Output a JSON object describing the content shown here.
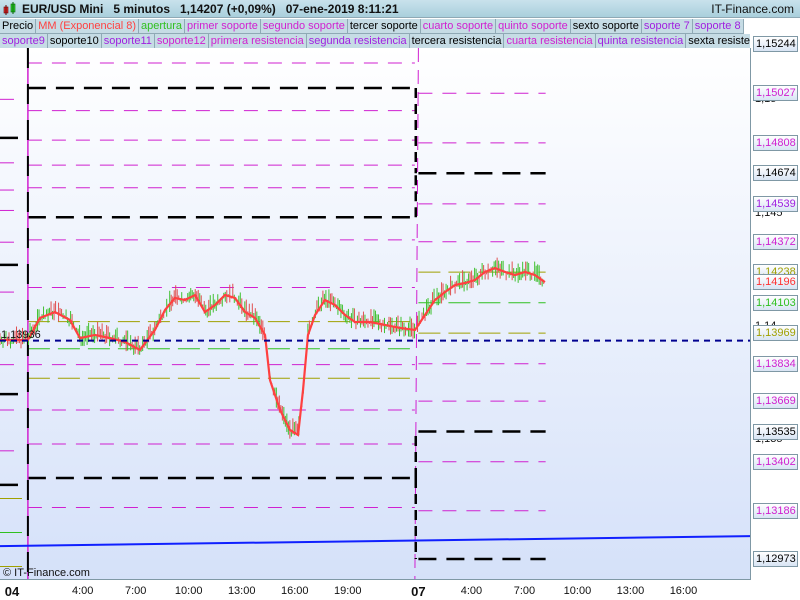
{
  "header": {
    "title": "EUR/USD Mini   5 minutos   1,14207 (+0,09%)   07-ene-2019 8:11:21",
    "brand": "IT-Finance.com"
  },
  "legend_row1": [
    {
      "label": "Precio",
      "color": "#000000"
    },
    {
      "label": "MM (Exponencial 8)",
      "color": "#ff4040"
    },
    {
      "label": "apertura",
      "color": "#30c020"
    },
    {
      "label": "primer soporte",
      "color": "#d020d0"
    },
    {
      "label": "segundo soporte",
      "color": "#d020d0"
    },
    {
      "label": "tercer soporte",
      "color": "#000000"
    },
    {
      "label": "cuarto soporte",
      "color": "#d020d0"
    },
    {
      "label": "quinto soporte",
      "color": "#d020d0"
    },
    {
      "label": "sexto soporte",
      "color": "#000000"
    },
    {
      "label": "soporte 7",
      "color": "#a020e0"
    },
    {
      "label": "soporte 8",
      "color": "#a020e0"
    }
  ],
  "legend_row2": [
    {
      "label": "soporte9",
      "color": "#a020e0"
    },
    {
      "label": "soporte10",
      "color": "#000000"
    },
    {
      "label": "soporte11",
      "color": "#a020e0"
    },
    {
      "label": "soporte12",
      "color": "#d020d0"
    },
    {
      "label": "primera resistencia",
      "color": "#d020d0"
    },
    {
      "label": "segunda resistencia",
      "color": "#a020e0"
    },
    {
      "label": "tercera resistencia",
      "color": "#000000"
    },
    {
      "label": "cuarta resistencia",
      "color": "#d020d0"
    },
    {
      "label": "quinta resistencia",
      "color": "#a020e0"
    },
    {
      "label": "sexta resistencia",
      "color": "#000000"
    }
  ],
  "price_labels": [
    {
      "value": "1,15244",
      "color": "#000000"
    },
    {
      "value": "1,15027",
      "color": "#d020d0"
    },
    {
      "value": "1,14808",
      "color": "#d020d0"
    },
    {
      "value": "1,14674",
      "color": "#000000"
    },
    {
      "value": "1,14539",
      "color": "#a020e0"
    },
    {
      "value": "1,14372",
      "color": "#d020d0"
    },
    {
      "value": "1,14238",
      "color": "#a0a000"
    },
    {
      "value": "1,14196",
      "color": "#ff3030"
    },
    {
      "value": "1,14103",
      "color": "#30c020"
    },
    {
      "value": "1,13969",
      "color": "#a0a000"
    },
    {
      "value": "1,13834",
      "color": "#d020d0"
    },
    {
      "value": "1,13669",
      "color": "#d020d0"
    },
    {
      "value": "1,13535",
      "color": "#000000"
    },
    {
      "value": "1,13402",
      "color": "#d020d0"
    },
    {
      "value": "1,13186",
      "color": "#d020d0"
    },
    {
      "value": "1,12973",
      "color": "#000000"
    }
  ],
  "grid_ticks": [
    "1,15",
    "1,145",
    "1,14",
    "1,135"
  ],
  "current_price_label": "1,13936",
  "copyright": "© IT-Finance.com",
  "x_labels": [
    {
      "t": 0,
      "label": "04",
      "day": true
    },
    {
      "t": 4,
      "label": "4:00"
    },
    {
      "t": 7,
      "label": "7:00"
    },
    {
      "t": 10,
      "label": "10:00"
    },
    {
      "t": 13,
      "label": "13:00"
    },
    {
      "t": 16,
      "label": "16:00"
    },
    {
      "t": 19,
      "label": "19:00"
    },
    {
      "t": 23,
      "label": "07",
      "day": true
    },
    {
      "t": 26,
      "label": "4:00"
    },
    {
      "t": 29,
      "label": "7:00"
    },
    {
      "t": 32,
      "label": "10:00"
    },
    {
      "t": 35,
      "label": "13:00"
    },
    {
      "t": 38,
      "label": "16:00"
    }
  ],
  "chart_data": {
    "type": "line",
    "y_range": [
      1.12973,
      1.15244
    ],
    "x_range_hours": [
      -0.68,
      41.8
    ],
    "price_series": {
      "t": [
        -0.68,
        0.9,
        1.58,
        2.43,
        3.28,
        3.85,
        4.7,
        5.55,
        6.4,
        7.24,
        8.09,
        8.66,
        9.22,
        9.79,
        10.36,
        10.92,
        11.49,
        12.05,
        12.62,
        13.19,
        13.75,
        14.32,
        14.6,
        15.17,
        15.73,
        16.19,
        16.47,
        16.75,
        17.15,
        17.71,
        18.28,
        18.85,
        19.41,
        20.26,
        21.11,
        21.96,
        22.81,
        23.37,
        23.94,
        24.5,
        25.07,
        25.64,
        26.2,
        26.77,
        27.33,
        27.9,
        28.47,
        29.03,
        29.6,
        30.16
      ],
      "close": [
        1.13939,
        1.13939,
        1.14036,
        1.14062,
        1.14027,
        1.13947,
        1.13961,
        1.13947,
        1.1393,
        1.13895,
        1.13983,
        1.14071,
        1.14124,
        1.14115,
        1.14137,
        1.14062,
        1.14093,
        1.14137,
        1.14124,
        1.14062,
        1.14036,
        1.13961,
        1.13762,
        1.1363,
        1.13542,
        1.1352,
        1.13718,
        1.13961,
        1.14049,
        1.14115,
        1.14093,
        1.14049,
        1.14018,
        1.14018,
        1.14005,
        1.13992,
        1.13983,
        1.14049,
        1.14115,
        1.1415,
        1.14181,
        1.1419,
        1.14203,
        1.14239,
        1.14256,
        1.14239,
        1.14225,
        1.14239,
        1.14225,
        1.14194
      ]
    },
    "current_price_line": 1.13936,
    "trend_line": {
      "from": 1.1303,
      "to": 1.13074
    },
    "day1_levels": {
      "t": [
        0.9,
        22.8
      ],
      "black": [
        1.1505,
        1.1448,
        1.1333
      ],
      "magenta": [
        1.1516,
        1.1495,
        1.1482,
        1.1471,
        1.1461,
        1.1438,
        1.1417,
        1.1383,
        1.1363,
        1.1348,
        1.132
      ],
      "olive": [
        1.1402,
        1.1377
      ],
      "green": [
        1.139
      ]
    },
    "day2_levels": {
      "t": [
        23,
        30.2
      ],
      "black": [
        1.14674,
        1.13535,
        1.12973
      ],
      "magenta": [
        1.15027,
        1.14808,
        1.14539,
        1.14372,
        1.13834,
        1.13669,
        1.13402,
        1.13186
      ],
      "olive": [
        1.14238,
        1.13969
      ],
      "green": [
        1.14103
      ]
    },
    "prev_levels": {
      "t": [
        -0.68,
        0.6
      ],
      "black": [
        1.1483,
        1.1427,
        1.137,
        1.133
      ],
      "magenta": [
        1.15,
        1.1472,
        1.146,
        1.1451,
        1.1437,
        1.1415,
        1.1383,
        1.1363,
        1.1345
      ],
      "olive": [
        1.1324,
        1.1294
      ],
      "green": [
        1.1309
      ]
    }
  }
}
